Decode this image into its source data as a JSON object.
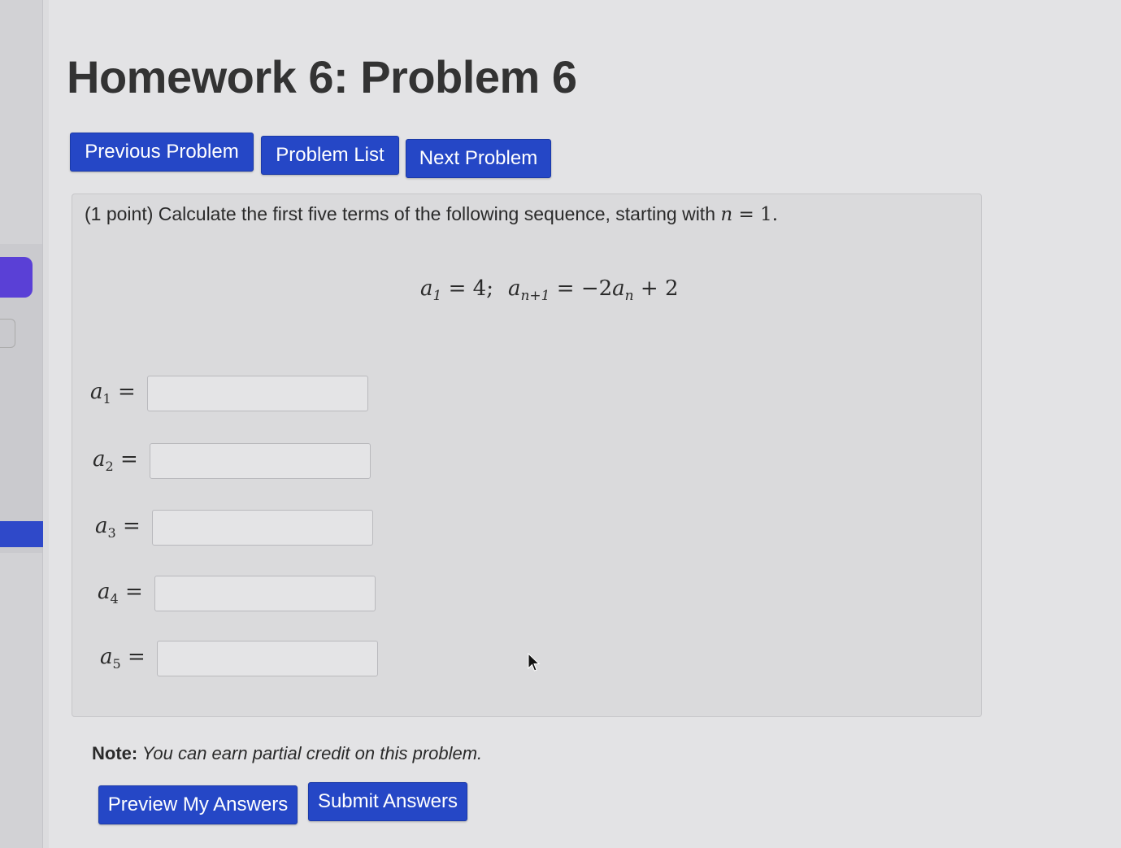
{
  "page": {
    "title": "Homework 6: Problem 6"
  },
  "nav": {
    "previous_label": "Previous Problem",
    "list_label": "Problem List",
    "next_label": "Next Problem"
  },
  "problem": {
    "intro": "(1 point) Calculate the first five terms of the following sequence, starting with ",
    "n_var": "n",
    "n_eq": " = ",
    "n_value": "1",
    "n_end": ".",
    "recurrence": {
      "first_base": "a",
      "first_sub": "1",
      "first_rhs": " = 4;",
      "next_base": "a",
      "next_sub": "n+1",
      "eq": " = −2",
      "term_base": "a",
      "term_sub": "n",
      "tail": " + 2"
    },
    "answers": [
      {
        "base": "a",
        "sub": "1",
        "eq": " =",
        "value": ""
      },
      {
        "base": "a",
        "sub": "2",
        "eq": " =",
        "value": ""
      },
      {
        "base": "a",
        "sub": "3",
        "eq": " =",
        "value": ""
      },
      {
        "base": "a",
        "sub": "4",
        "eq": " =",
        "value": ""
      },
      {
        "base": "a",
        "sub": "5",
        "eq": " =",
        "value": ""
      }
    ]
  },
  "note": {
    "label": "Note:",
    "text": " You can earn partial credit on this problem."
  },
  "actions": {
    "preview_label": "Preview My Answers",
    "submit_label": "Submit Answers"
  },
  "colors": {
    "button_blue": "#2547c6",
    "rail_purple": "#5a40d6",
    "rail_blue": "#2f49c9"
  }
}
